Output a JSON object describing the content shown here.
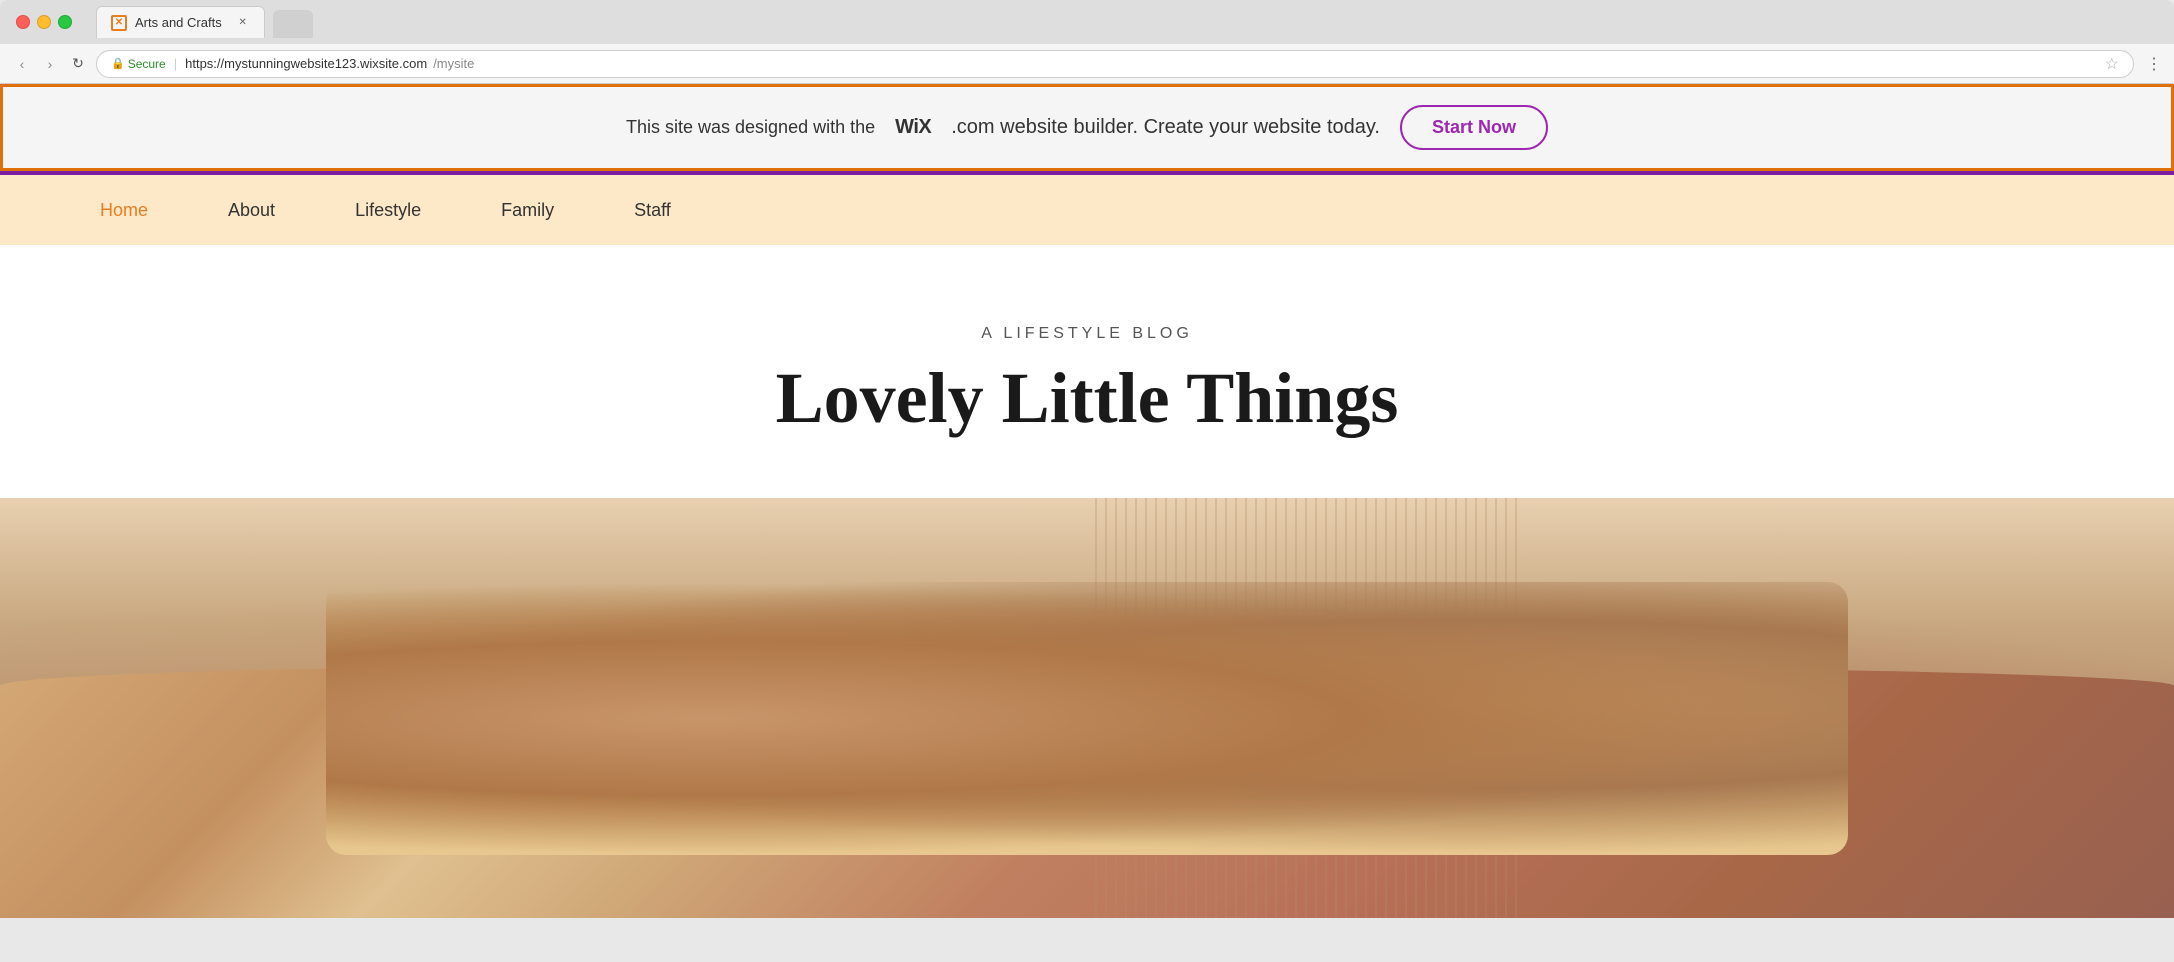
{
  "browser": {
    "tab_title": "Arts and Crafts",
    "tab_favicon_symbol": "✕",
    "nav_back": "‹",
    "nav_forward": "›",
    "nav_refresh": "↻",
    "secure_label": "Secure",
    "url_base": "https://mystunningwebsite123.wixsite.com",
    "url_path": "/mysite",
    "star_icon": "☆",
    "menu_icon": "⋮"
  },
  "banner": {
    "text_before": "This site was designed with the ",
    "wix_bold": "WiX",
    "text_after": ".com website builder. Create your website today.",
    "button_label": "Start Now",
    "border_color": "#e0700a",
    "button_color": "#9c27b0"
  },
  "nav": {
    "items": [
      {
        "label": "Home",
        "active": true
      },
      {
        "label": "About",
        "active": false
      },
      {
        "label": "Lifestyle",
        "active": false
      },
      {
        "label": "Family",
        "active": false
      },
      {
        "label": "Staff",
        "active": false
      }
    ]
  },
  "hero": {
    "subtitle": "A LIFESTYLE BLOG",
    "title": "Lovely Little Things"
  }
}
